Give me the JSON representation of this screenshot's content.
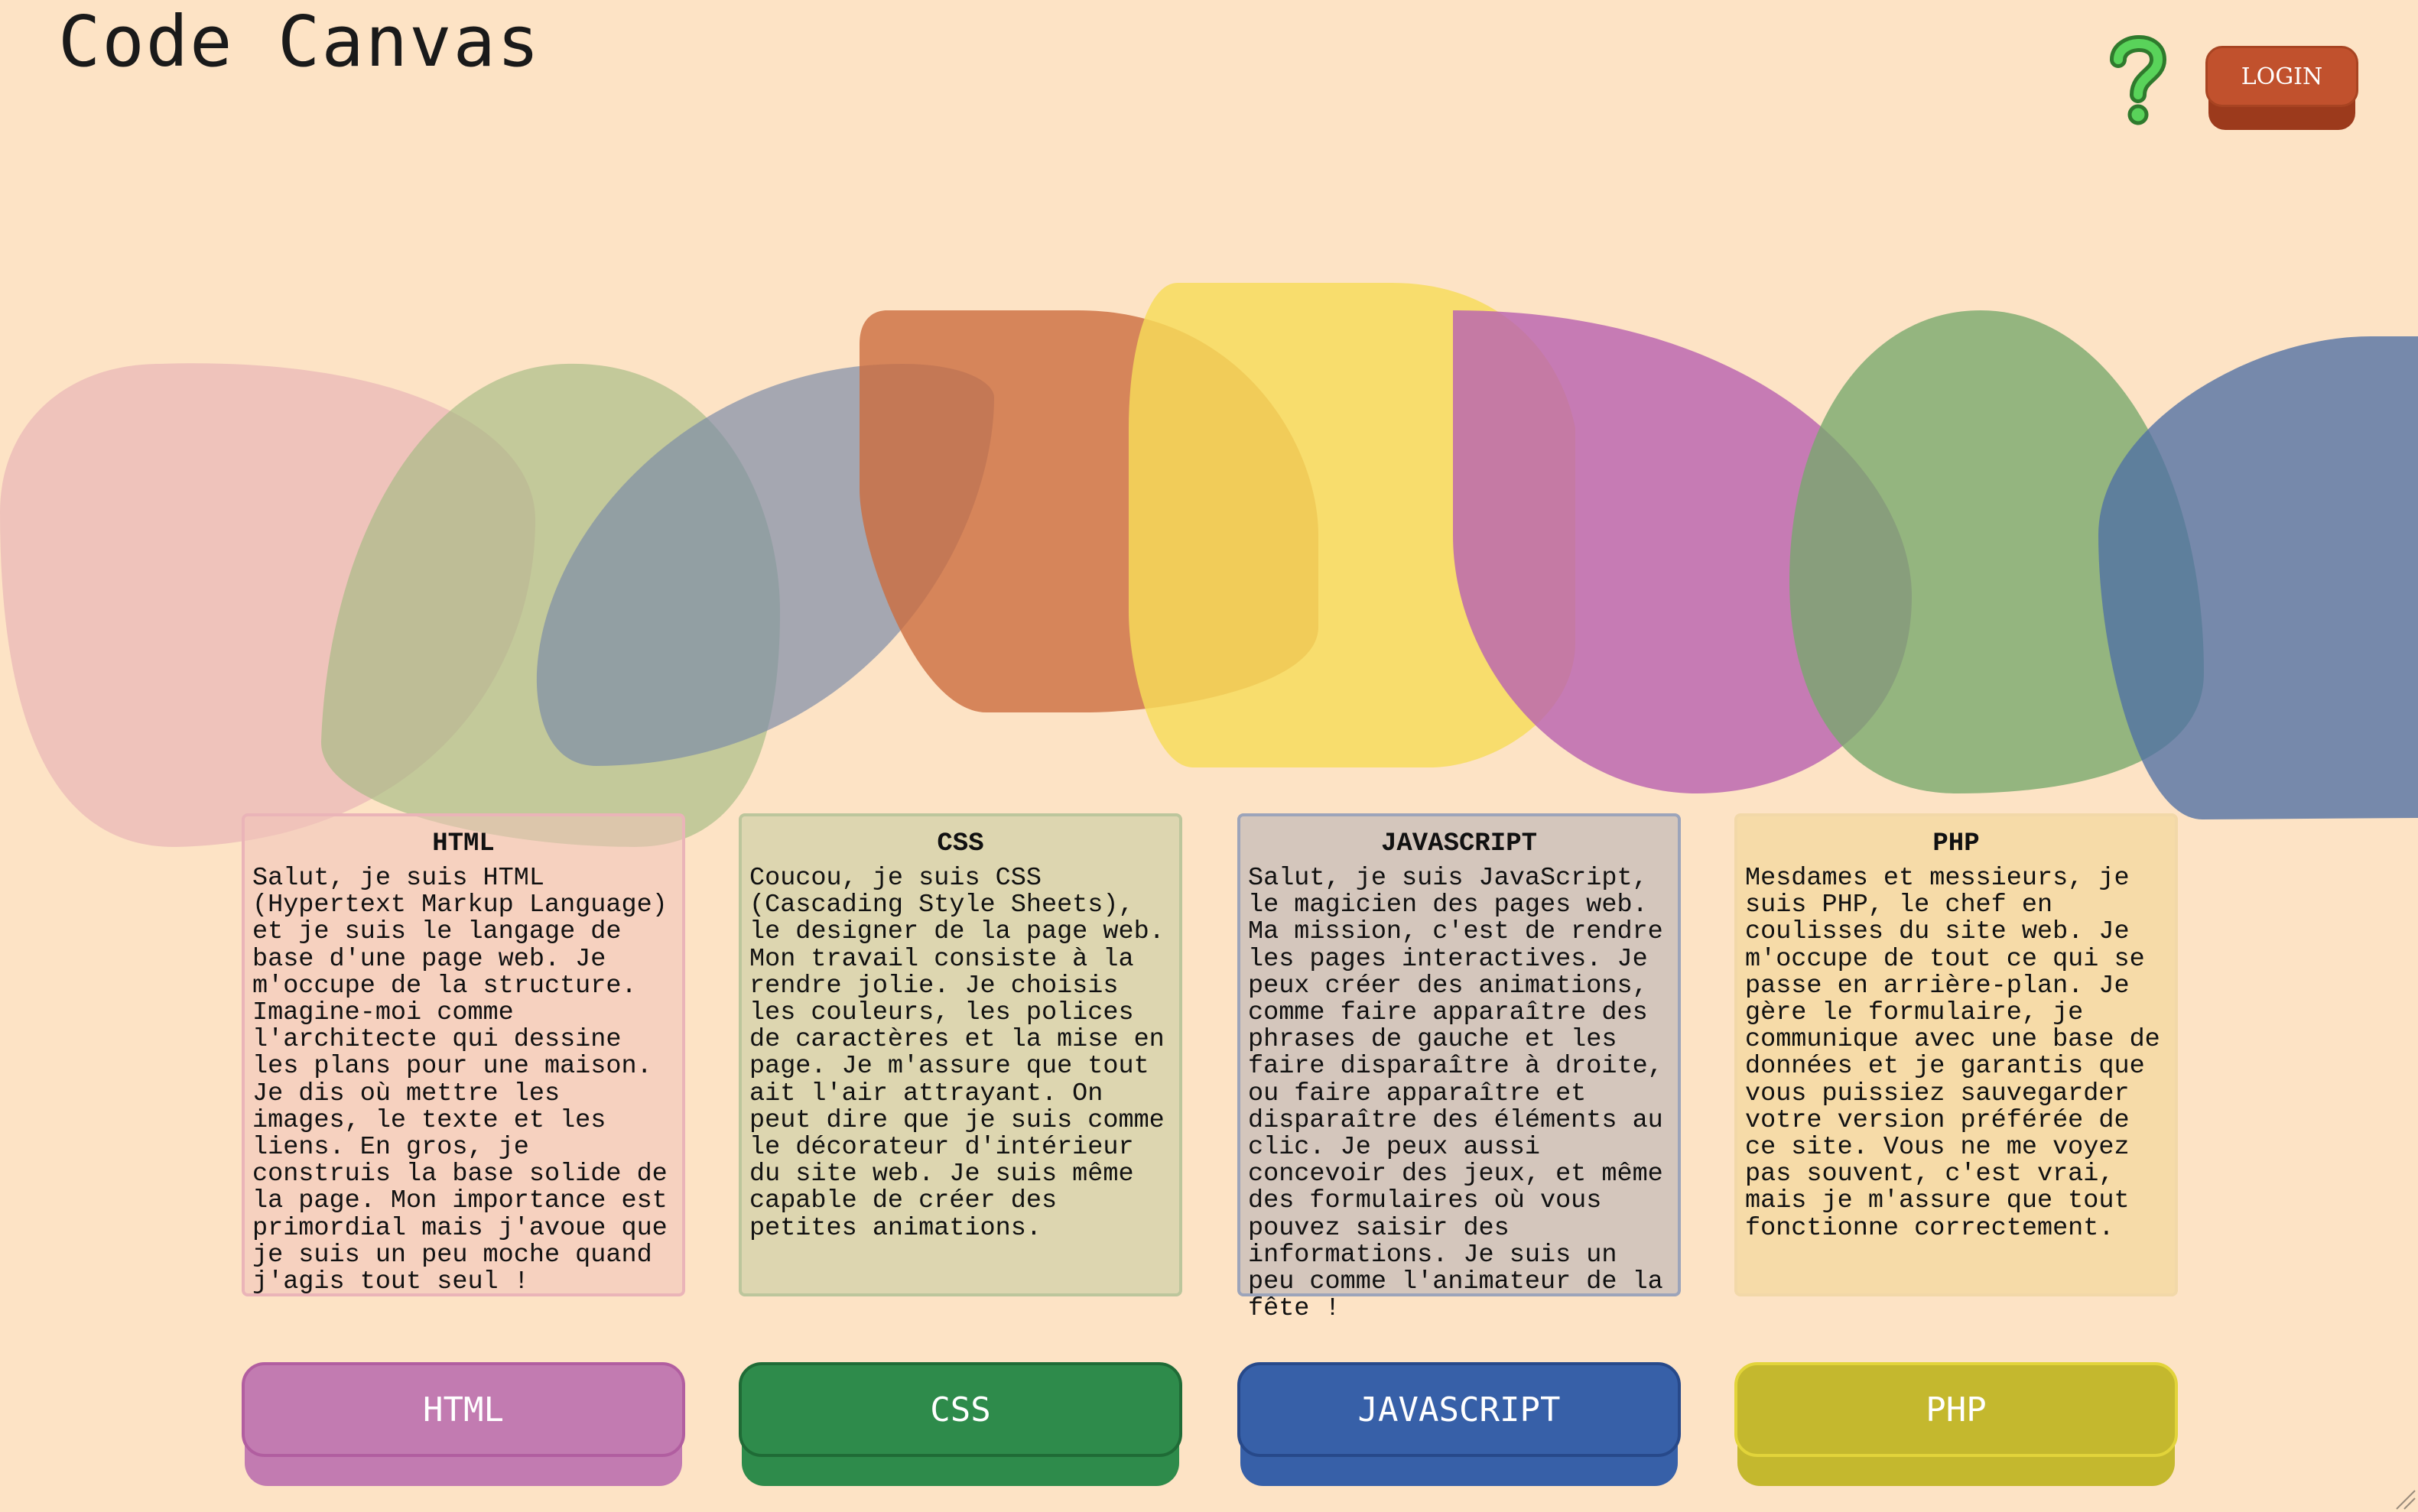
{
  "header": {
    "title": "Code Canvas",
    "help_icon": "question-mark-icon",
    "login_label": "LOGIN"
  },
  "colors": {
    "background": "#fde3c5",
    "login": "#c1512d",
    "html": "#c27bb1",
    "css": "#2e8b4b",
    "javascript": "#3760a8",
    "php": "#c4b82e"
  },
  "cards": [
    {
      "title": "HTML",
      "text": "Salut, je suis HTML (Hypertext Markup Language) et je suis le langage de base d'une page web. Je m'occupe de la structure. Imagine-moi comme l'architecte qui dessine les plans pour une maison. Je dis où mettre les images, le texte et les liens. En gros, je construis la base solide de la page. Mon importance est primordial mais j'avoue que je suis un peu moche quand j'agis tout seul !"
    },
    {
      "title": "CSS",
      "text": "Coucou, je suis CSS (Cascading Style Sheets), le designer de la page web. Mon travail consiste à la rendre jolie. Je choisis les couleurs, les polices de caractères et la mise en page. Je m'assure que tout ait l'air attrayant. On peut dire que je suis comme le décorateur d'intérieur du site web. Je suis même capable de créer des petites animations."
    },
    {
      "title": "JAVASCRIPT",
      "text": "Salut, je suis JavaScript, le magicien des pages web. Ma mission, c'est de rendre les pages interactives. Je peux créer des animations, comme faire apparaître des phrases de gauche et les faire disparaître à droite, ou faire apparaître et disparaître des éléments au clic. Je peux aussi concevoir des jeux, et même des formulaires où vous pouvez saisir des informations. Je suis un peu comme l'animateur de la fête !"
    },
    {
      "title": "PHP",
      "text": "Mesdames et messieurs, je suis PHP, le chef en coulisses du site web. Je m'occupe de tout ce qui se passe en arrière-plan. Je gère le formulaire, je communique avec une base de données et je garantis que vous puissiez sauvegarder votre version préférée de ce site. Vous ne me voyez pas souvent, c'est vrai, mais je m'assure que tout fonctionne correctement."
    }
  ],
  "buttons": [
    {
      "label": "HTML"
    },
    {
      "label": "CSS"
    },
    {
      "label": "JAVASCRIPT"
    },
    {
      "label": "PHP"
    }
  ]
}
